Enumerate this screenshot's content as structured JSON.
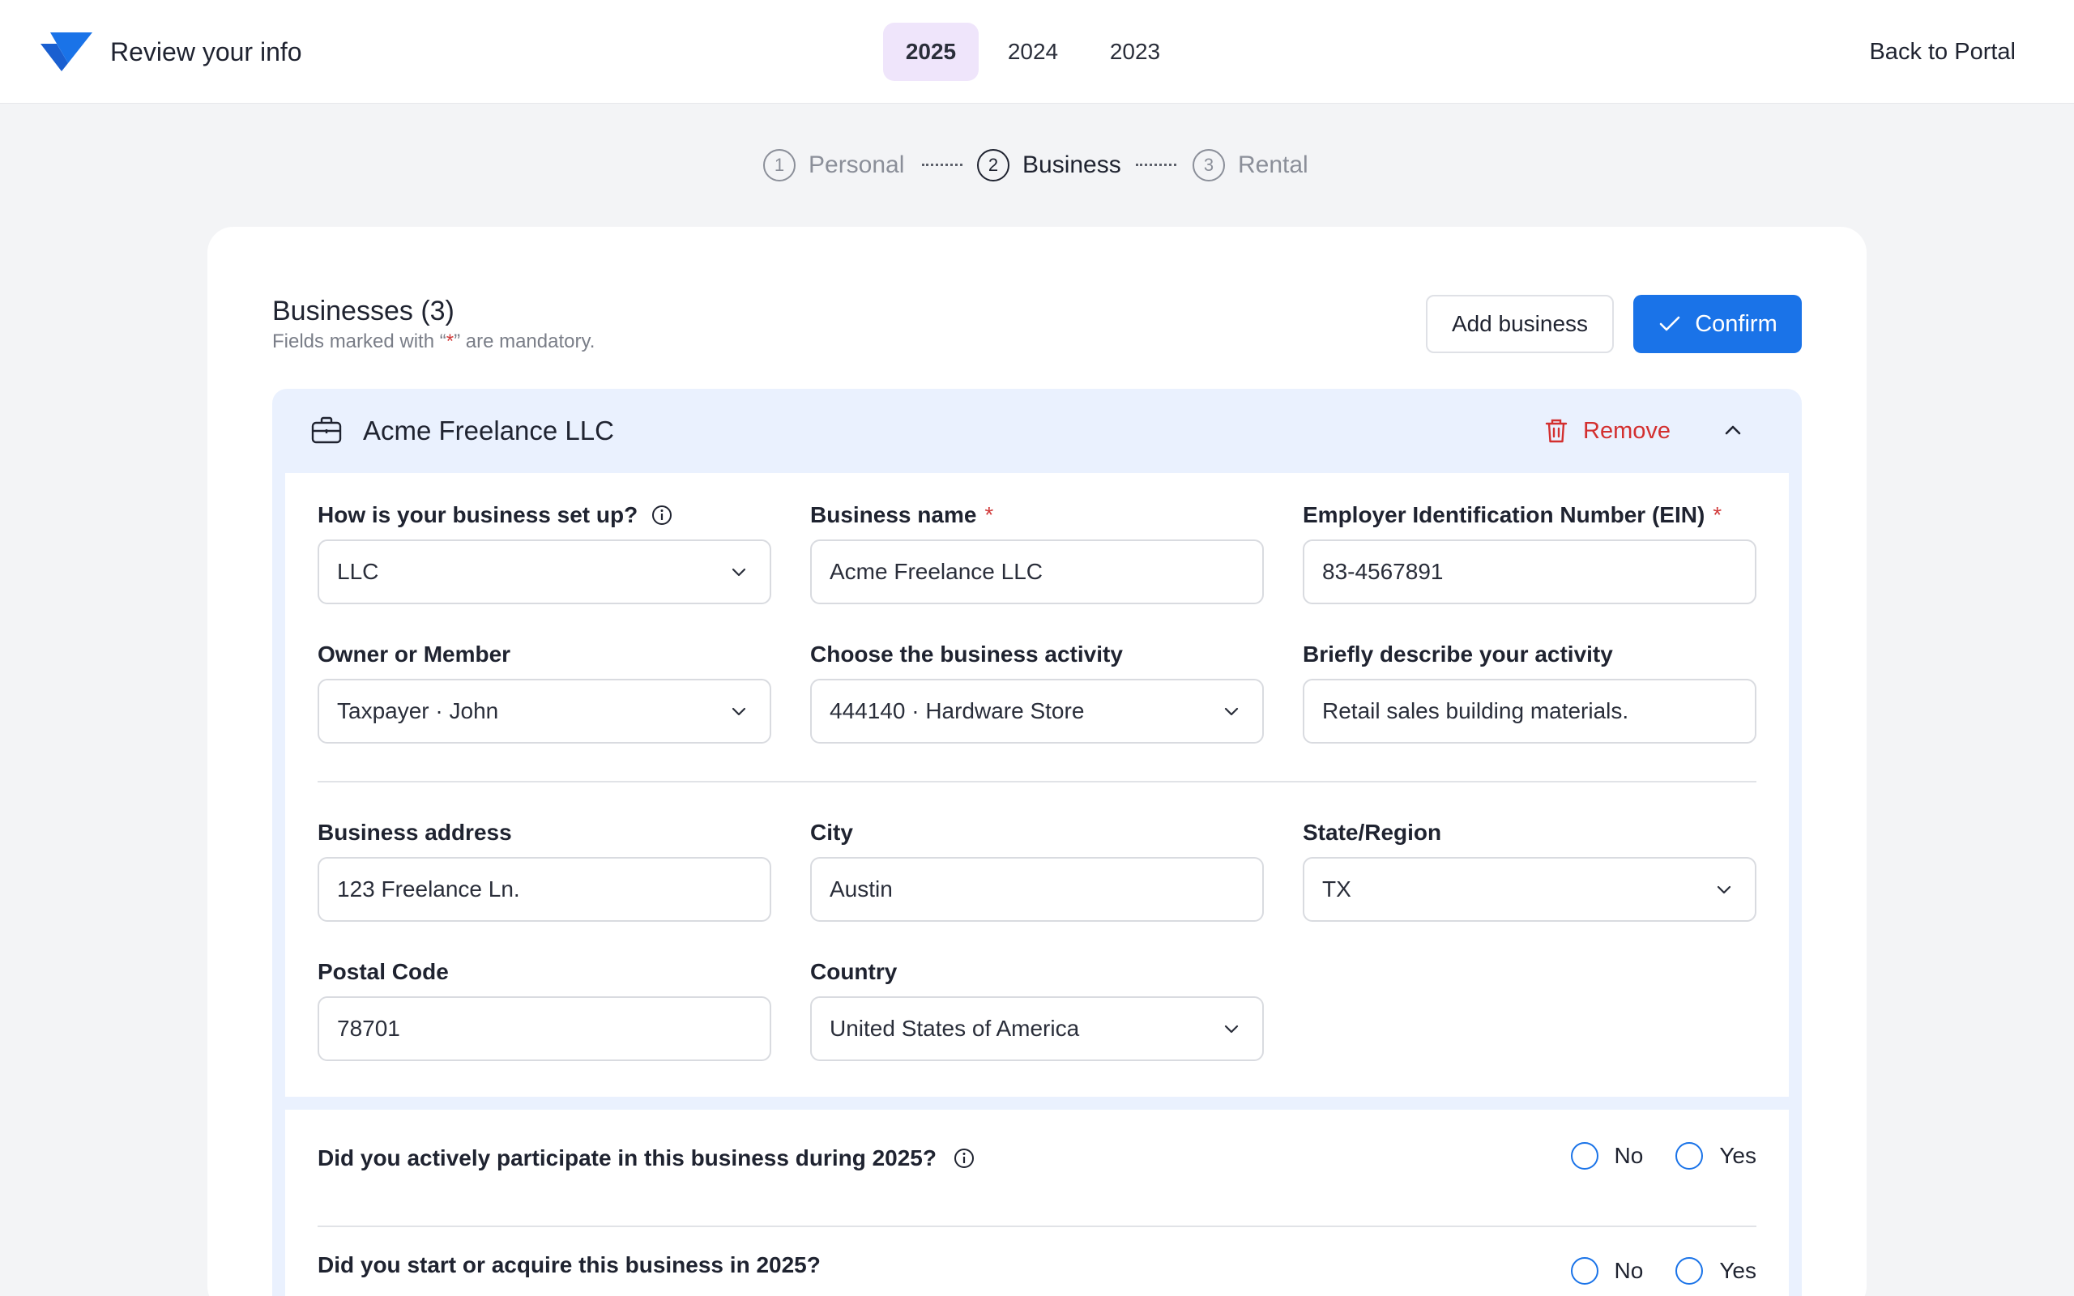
{
  "header": {
    "title": "Review your info",
    "years": [
      "2025",
      "2024",
      "2023"
    ],
    "active_year": "2025",
    "back_label": "Back to Portal"
  },
  "stepper": {
    "steps": [
      {
        "num": "1",
        "label": "Personal"
      },
      {
        "num": "2",
        "label": "Business"
      },
      {
        "num": "3",
        "label": "Rental"
      }
    ],
    "active": 2
  },
  "section": {
    "title": "Businesses (3)",
    "hint_prefix": "Fields marked with “",
    "hint_star": "*",
    "hint_suffix": "” are mandatory.",
    "add_label": "Add business",
    "confirm_label": "Confirm"
  },
  "business": {
    "name": "Acme Freelance LLC",
    "remove_label": "Remove",
    "fields": {
      "setup": {
        "label": "How is your business set up?",
        "value": "LLC"
      },
      "business_name": {
        "label": "Business name",
        "required": "*",
        "value": "Acme Freelance LLC"
      },
      "ein": {
        "label": "Employer Identification Number (EIN)",
        "required": "*",
        "value": "83-4567891"
      },
      "owner": {
        "label": "Owner or Member",
        "value": "Taxpayer · John"
      },
      "activity": {
        "label": "Choose the business activity",
        "value": "444140 · Hardware Store"
      },
      "description": {
        "label": "Briefly describe your activity",
        "value": "Retail sales building materials."
      },
      "address": {
        "label": "Business address",
        "value": "123 Freelance Ln."
      },
      "city": {
        "label": "City",
        "value": "Austin"
      },
      "state": {
        "label": "State/Region",
        "value": "TX"
      },
      "postal": {
        "label": "Postal Code",
        "value": "78701"
      },
      "country": {
        "label": "Country",
        "value": "United States of America"
      }
    },
    "questions": [
      {
        "text": "Did you actively participate in this business during 2025?",
        "no": "No",
        "yes": "Yes"
      },
      {
        "text": "Did you start or acquire this business in 2025?",
        "no": "No",
        "yes": "Yes"
      }
    ]
  },
  "colors": {
    "accent": "#1a73e8",
    "active_year_bg": "#efe5fb",
    "danger": "#d32f2f",
    "panel_bg": "#eaf1fe"
  }
}
